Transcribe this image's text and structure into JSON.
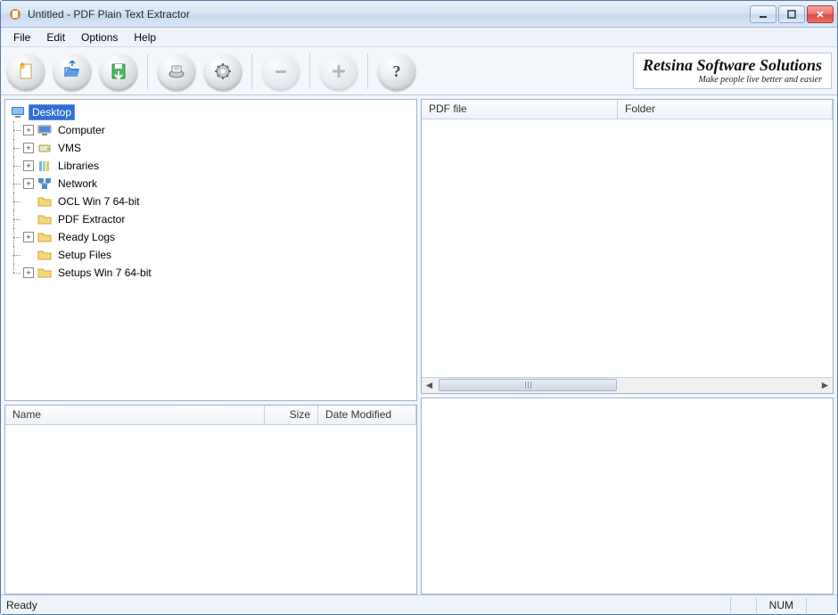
{
  "window": {
    "title": "Untitled - PDF Plain Text Extractor"
  },
  "menubar": {
    "items": [
      "File",
      "Edit",
      "Options",
      "Help"
    ]
  },
  "toolbar": {
    "buttons": [
      {
        "name": "new-document",
        "color": "#f4c24a",
        "accent": "#e78b2a"
      },
      {
        "name": "open-folder",
        "color": "#5aa0e6",
        "accent": "#2f72c3"
      },
      {
        "name": "save",
        "color": "#4fb868",
        "accent": "#2a8a42"
      },
      {
        "name": "scan",
        "color": "#8c8c96",
        "accent": "#5f5f6a",
        "sep_before": true
      },
      {
        "name": "settings",
        "color": "#8c8c96",
        "accent": "#5f5f6a"
      },
      {
        "name": "remove",
        "color": "#9aa0a6",
        "accent": "#6f757b",
        "disabled": true,
        "sep_before": true
      },
      {
        "name": "add",
        "color": "#9aa0a6",
        "accent": "#6f757b",
        "disabled": true,
        "sep_before": true
      },
      {
        "name": "help",
        "color": "#6f6f78",
        "accent": "#3f3f48",
        "sep_before": true
      }
    ]
  },
  "brand": {
    "name": "Retsina Software Solutions",
    "tagline": "Make people live better and easier"
  },
  "tree": {
    "root": {
      "label": "Desktop",
      "selected": true,
      "icon": "desktop-icon"
    },
    "children": [
      {
        "label": "Computer",
        "expandable": true,
        "icon": "computer-icon"
      },
      {
        "label": "VMS",
        "expandable": true,
        "icon": "drive-icon"
      },
      {
        "label": "Libraries",
        "expandable": true,
        "icon": "libraries-icon"
      },
      {
        "label": "Network",
        "expandable": true,
        "icon": "network-icon"
      },
      {
        "label": "OCL Win 7 64-bit",
        "expandable": false,
        "icon": "folder-icon"
      },
      {
        "label": "PDF Extractor",
        "expandable": false,
        "icon": "folder-icon"
      },
      {
        "label": "Ready Logs",
        "expandable": true,
        "icon": "folder-icon"
      },
      {
        "label": "Setup Files",
        "expandable": false,
        "icon": "folder-icon"
      },
      {
        "label": "Setups Win 7 64-bit",
        "expandable": true,
        "icon": "folder-icon"
      }
    ]
  },
  "file_list": {
    "columns": [
      "Name",
      "Size",
      "Date Modified"
    ]
  },
  "pdf_list": {
    "columns": [
      "PDF file",
      "Folder"
    ]
  },
  "status": {
    "text": "Ready",
    "indicator": "NUM"
  }
}
